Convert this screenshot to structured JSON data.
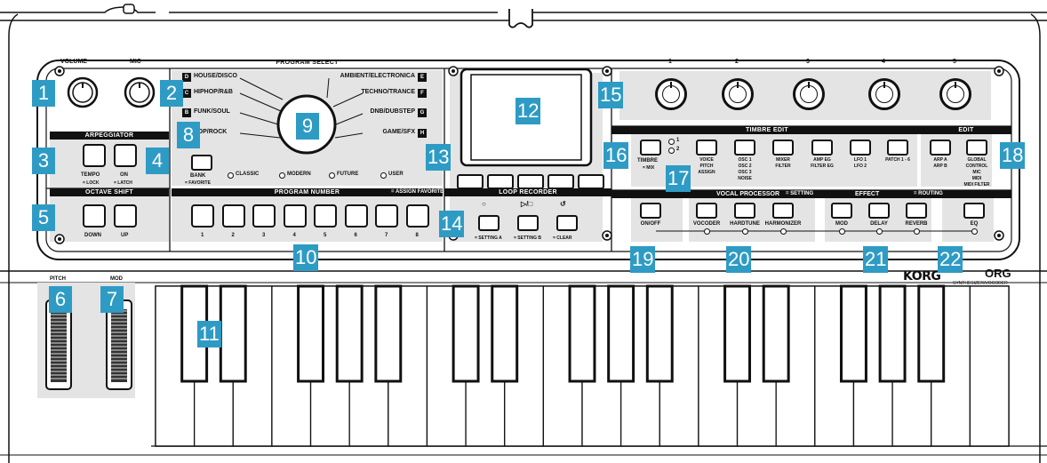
{
  "sections": {
    "volume": "VOLUME",
    "mic": "MIC",
    "program_select": "PROGRAM SELECT",
    "arpeggiator": "ARPEGGIATOR",
    "octave_shift": "OCTAVE SHIFT",
    "program_number": "PROGRAM NUMBER",
    "assign_favorite": "= ASSIGN FAVORITE",
    "loop_recorder": "LOOP RECORDER",
    "timbre_edit": "TIMBRE EDIT",
    "edit": "EDIT",
    "vocal_processor": "VOCAL PROCESSOR",
    "vocal_setting": "= SETTING",
    "effect": "EFFECT",
    "effect_routing": "= ROUTING"
  },
  "knob_numbers": [
    "1",
    "2",
    "3",
    "4",
    "5"
  ],
  "genres_left": [
    {
      "tag": "D",
      "label": "HOUSE/DISCO"
    },
    {
      "tag": "C",
      "label": "HIPHOP/R&B"
    },
    {
      "tag": "B",
      "label": "FUNK/SOUL"
    },
    {
      "tag": "A",
      "label": "POP/ROCK"
    }
  ],
  "genres_right": [
    {
      "tag": "E",
      "label": "AMBIENT/ELECTRONICA"
    },
    {
      "tag": "F",
      "label": "TECHNO/TRANCE"
    },
    {
      "tag": "G",
      "label": "DNB/DUBSTEP"
    },
    {
      "tag": "H",
      "label": "GAME/SFX"
    }
  ],
  "bank": {
    "label": "BANK",
    "sub": "= FAVORITE"
  },
  "categories": [
    "CLASSIC",
    "MODERN",
    "FUTURE",
    "USER"
  ],
  "arp_buttons": [
    {
      "label": "TEMPO",
      "sub": "= LOCK"
    },
    {
      "label": "ON",
      "sub": "= LATCH"
    }
  ],
  "octave_buttons": [
    "DOWN",
    "UP"
  ],
  "program_numbers": [
    "1",
    "2",
    "3",
    "4",
    "5",
    "6",
    "7",
    "8"
  ],
  "loop_buttons": [
    {
      "symbol": "○",
      "sub": "= SETTING A"
    },
    {
      "symbol": "▷/□",
      "sub": "= SETTING B"
    },
    {
      "symbol": "↺",
      "sub": "= CLEAR"
    }
  ],
  "timbre": {
    "label": "TIMBRE",
    "sub": "= MIX",
    "led1": "1",
    "led2": "2"
  },
  "timbre_buttons": [
    [
      "VOICE",
      "PITCH",
      "ASSIGN"
    ],
    [
      "OSC 1",
      "OSC 2",
      "OSC 3",
      "NOISE"
    ],
    [
      "MIXER",
      "FILTER"
    ],
    [
      "AMP EG",
      "FILTER EG"
    ],
    [
      "LFO 1",
      "LFO 2"
    ],
    [
      "PATCH 1 - 6"
    ]
  ],
  "edit_buttons": [
    [
      "ARP A",
      "ARP B"
    ],
    [
      "GLOBAL",
      "CONTROL",
      "MIC",
      "MIDI",
      "MIDI FILTER"
    ]
  ],
  "on_off": "ON/OFF",
  "vocal_buttons": [
    "VOCODER",
    "HARDTUNE",
    "HARMONIZER"
  ],
  "effect_buttons": [
    "MOD",
    "DELAY",
    "REVERB"
  ],
  "eq": "EQ",
  "wheels": {
    "pitch": "PITCH",
    "mod": "MOD"
  },
  "brand": {
    "logo": "KORG",
    "product": "microKORG",
    "product_partial": "ORG",
    "sub": "SYNTHESIZER/VOCODER"
  },
  "callouts": [
    "1",
    "2",
    "3",
    "4",
    "5",
    "6",
    "7",
    "8",
    "9",
    "10",
    "11",
    "12",
    "13",
    "14",
    "15",
    "16",
    "17",
    "18",
    "19",
    "20",
    "21",
    "22"
  ],
  "colors": {
    "callout": "#2e9bc4",
    "panel": "#e4e4e4",
    "outline": "#111111"
  }
}
